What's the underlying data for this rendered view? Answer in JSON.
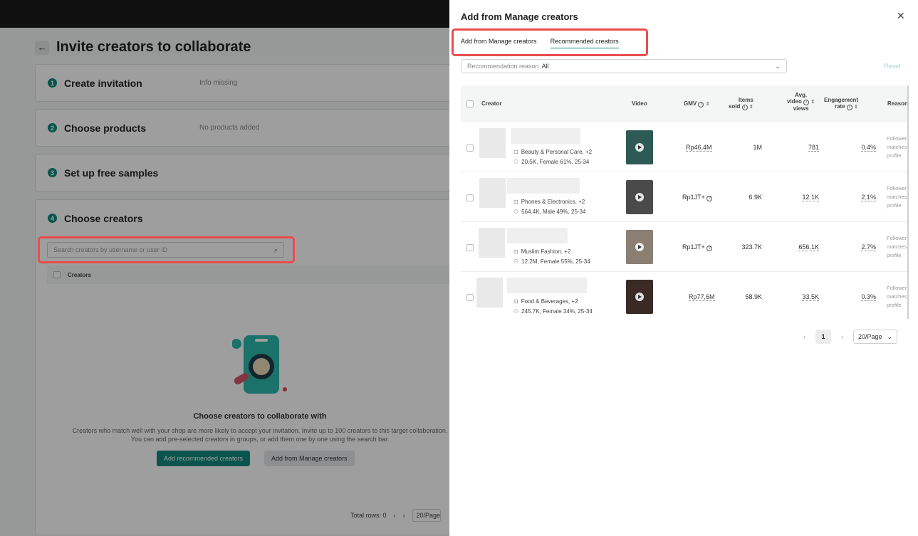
{
  "page": {
    "title": "Invite creators to collaborate",
    "steps": [
      {
        "num": "1",
        "title": "Create invitation",
        "hint": "Info missing"
      },
      {
        "num": "2",
        "title": "Choose products",
        "hint": "No products added"
      },
      {
        "num": "3",
        "title": "Set up free samples",
        "hint": ""
      },
      {
        "num": "4",
        "title": "Choose creators",
        "hint": ""
      }
    ],
    "search_placeholder": "Search creators by username or user ID",
    "creators_col": "Creators",
    "empty_title": "Choose creators to collaborate with",
    "empty_desc_1": "Creators who match well with your shop are more likely to accept your invitation. Invite up to 100 creators to this target collaboration.",
    "empty_desc_2": "You can add pre-selected creators in groups, or add them one by one using the search bar.",
    "btn_recommended": "Add recommended creators",
    "btn_manage": "Add from Manage creators",
    "total_rows": "Total rows: 0",
    "page_size": "20/Page"
  },
  "drawer": {
    "title": "Add from Manage creators",
    "tabs": [
      "Add from Manage creators",
      "Recommended creators"
    ],
    "active_tab": "Recommended creators",
    "reason_label": "Recommendation reason",
    "reason_value": "All",
    "reset": "Reset",
    "columns": {
      "creator": "Creator",
      "video": "Video",
      "gmv": "GMV",
      "items_sold_1": "Items",
      "items_sold_2": "sold",
      "avg_1": "Avg.",
      "avg_2": "video",
      "avg_3": "views",
      "eng_1": "Engagement",
      "eng_2": "rate",
      "reason": "Reason"
    },
    "rows": [
      {
        "category": "Beauty & Personal Care, +2",
        "audience": "20.5K, Female 61%, 25-34",
        "gmv": "Rp46,4M",
        "items_sold": "1M",
        "avg_views": "781",
        "engagement": "0.4%",
        "reason": [
          "Follower",
          "matches",
          "profile"
        ]
      },
      {
        "category": "Phones & Electronics, +2",
        "audience": "564.4K, Male 49%, 25-34",
        "gmv": "Rp1JT+",
        "items_sold": "6.9K",
        "avg_views": "12.1K",
        "engagement": "2.1%",
        "reason": [
          "Follower",
          "matches",
          "profile"
        ]
      },
      {
        "category": "Muslim Fashion, +2",
        "audience": "12.2M, Female 55%, 25-34",
        "gmv": "Rp1JT+",
        "items_sold": "323.7K",
        "avg_views": "656.1K",
        "engagement": "2.7%",
        "reason": [
          "Follower",
          "matches",
          "profile"
        ]
      },
      {
        "category": "Food & Beverages, +2",
        "audience": "245.7K, Female 34%, 25-34",
        "gmv": "Rp77,6M",
        "items_sold": "58.9K",
        "avg_views": "33.5K",
        "engagement": "0.3%",
        "reason": [
          "Follower",
          "matches",
          "profile"
        ]
      }
    ],
    "pagination": {
      "current": "1",
      "page_size": "20/Page"
    }
  },
  "colors": {
    "accent": "#0f8a7d",
    "highlight": "#ea4c4c",
    "topbar": "#1a1a1a"
  }
}
